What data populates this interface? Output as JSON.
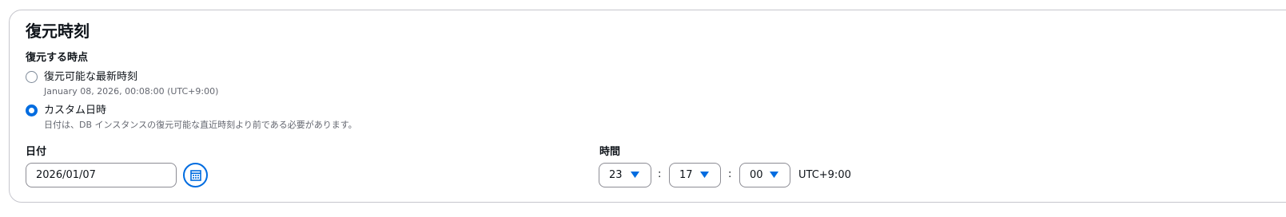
{
  "section": {
    "title": "復元時刻"
  },
  "restore_point": {
    "label": "復元する時点",
    "options": [
      {
        "label": "復元可能な最新時刻",
        "description": "January 08, 2026, 00:08:00 (UTC+9:00)",
        "selected": false
      },
      {
        "label": "カスタム日時",
        "description": "日付は、DB インスタンスの復元可能な直近時刻より前である必要があります。",
        "selected": true
      }
    ]
  },
  "date": {
    "label": "日付",
    "value": "2026/01/07",
    "calendar_icon": "calendar-icon"
  },
  "time": {
    "label": "時間",
    "hour": "23",
    "minute": "17",
    "second": "00",
    "separator": ":",
    "timezone": "UTC+9:00"
  },
  "colors": {
    "accent": "#006ce0",
    "border": "#8c8c94",
    "text": "#0f141a",
    "secondary_text": "#656871"
  }
}
